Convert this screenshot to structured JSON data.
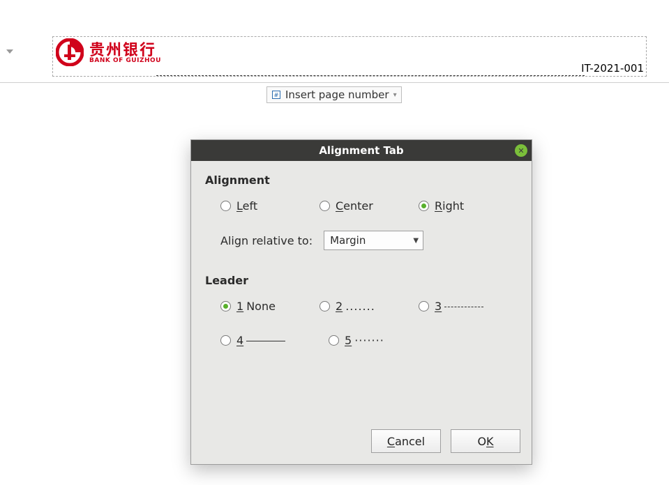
{
  "header": {
    "bank_name_cn": "贵州银行",
    "bank_name_en": "BANK OF GUIZHOU",
    "doc_code": "IT-2021-001"
  },
  "insert_chip": {
    "label": "Insert page number"
  },
  "dialog": {
    "title": "Alignment Tab",
    "alignment": {
      "section_label": "Alignment",
      "options": {
        "left": {
          "mnemonic": "L",
          "rest": "eft",
          "checked": false
        },
        "center": {
          "mnemonic": "C",
          "rest": "enter",
          "checked": false
        },
        "right": {
          "mnemonic": "R",
          "rest": "ight",
          "checked": true
        }
      },
      "relative_label": "Align relative to:",
      "relative_value": "Margin"
    },
    "leader": {
      "section_label": "Leader",
      "options": {
        "1": {
          "mnemonic": "1",
          "sample": "None",
          "checked": true
        },
        "2": {
          "mnemonic": "2",
          "sample": ".......",
          "checked": false
        },
        "3": {
          "mnemonic": "3",
          "sample": "-------",
          "checked": false
        },
        "4": {
          "mnemonic": "4",
          "sample": "",
          "checked": false
        },
        "5": {
          "mnemonic": "5",
          "sample": "·······",
          "checked": false
        }
      }
    },
    "buttons": {
      "cancel": {
        "mnemonic": "C",
        "rest": "ancel"
      },
      "ok": {
        "pre": "O",
        "mnemonic": "K"
      }
    }
  }
}
